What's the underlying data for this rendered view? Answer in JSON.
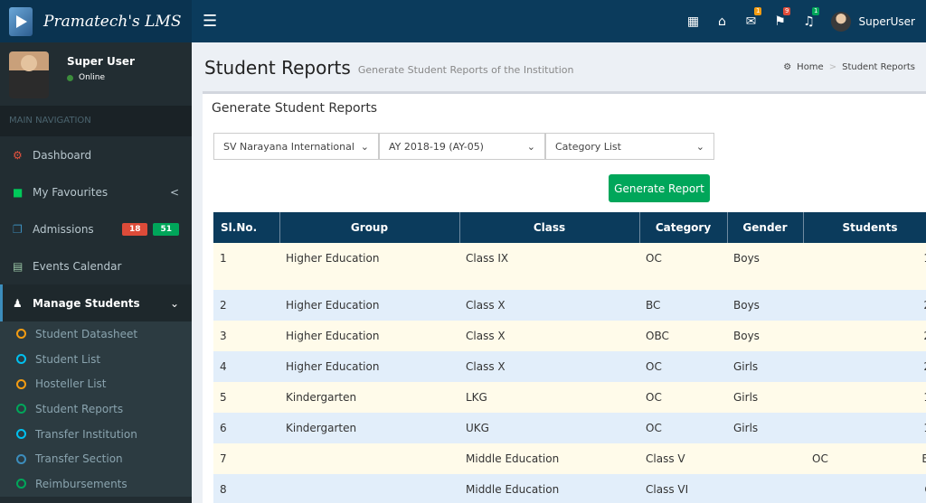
{
  "header": {
    "app_title": "Pramatech's LMS",
    "user_name": "SuperUser",
    "badges": {
      "mail": "1",
      "flags": "9",
      "bell": "1"
    },
    "colors": {
      "mail": "#f39c12",
      "flags": "#dd4b39",
      "bell": "#00a65a"
    }
  },
  "sidebar": {
    "user_name": "Super User",
    "status": "Online",
    "nav_header": "MAIN NAVIGATION",
    "items": [
      {
        "label": "Dashboard",
        "icon": "dashboard-icon",
        "color": "#e8533f"
      },
      {
        "label": "My Favourites",
        "icon": "briefcase-icon",
        "color": "#00c95a",
        "chevron": "<"
      },
      {
        "label": "Admissions",
        "icon": "copy-icon",
        "color": "#3c8dbc",
        "badges": [
          "18",
          "51"
        ]
      },
      {
        "label": "Events Calendar",
        "icon": "calendar-icon",
        "color": "#9ac6a6"
      },
      {
        "label": "Manage Students",
        "icon": "user-icon",
        "color": "#fff",
        "chevron": "⌄"
      }
    ],
    "subitems": [
      {
        "label": "Student Datasheet",
        "color": "#f39c12"
      },
      {
        "label": "Student List",
        "color": "#00c0ef"
      },
      {
        "label": "Hosteller List",
        "color": "#f39c12"
      },
      {
        "label": "Student Reports",
        "color": "#00a65a"
      },
      {
        "label": "Transfer Institution",
        "color": "#00c0ef"
      },
      {
        "label": "Transfer Section",
        "color": "#3c8dbc"
      },
      {
        "label": "Reimbursements",
        "color": "#00a65a"
      }
    ]
  },
  "page": {
    "title": "Student Reports",
    "subtitle": "Generate Student Reports of the Institution",
    "breadcrumb": [
      "Home",
      "Student Reports"
    ]
  },
  "report": {
    "box_title": "Generate Student Reports",
    "filters": [
      "SV Narayana International",
      "AY 2018-19 (AY-05)",
      "Category List"
    ],
    "button": "Generate Report",
    "columns": [
      "Sl.No.",
      "Group",
      "Class",
      "Category",
      "Gender",
      "Students"
    ],
    "rows": [
      [
        "1",
        "Higher Education",
        "Class IX",
        "OC",
        "Boys",
        "1"
      ],
      [
        "2",
        "Higher Education",
        "Class X",
        "BC",
        "Boys",
        "2"
      ],
      [
        "3",
        "Higher Education",
        "Class X",
        "OBC",
        "Boys",
        "2"
      ],
      [
        "4",
        "Higher Education",
        "Class X",
        "OC",
        "Girls",
        "2"
      ],
      [
        "5",
        "Kindergarten",
        "LKG",
        "OC",
        "Girls",
        "1"
      ],
      [
        "6",
        "Kindergarten",
        "UKG",
        "OC",
        "Girls",
        "1"
      ],
      [
        "7",
        "",
        "Middle Education",
        "Class V",
        "",
        "OC",
        "Bo"
      ],
      [
        "8",
        "",
        "Middle Education",
        "Class VI",
        "",
        "",
        "Gi"
      ]
    ]
  }
}
